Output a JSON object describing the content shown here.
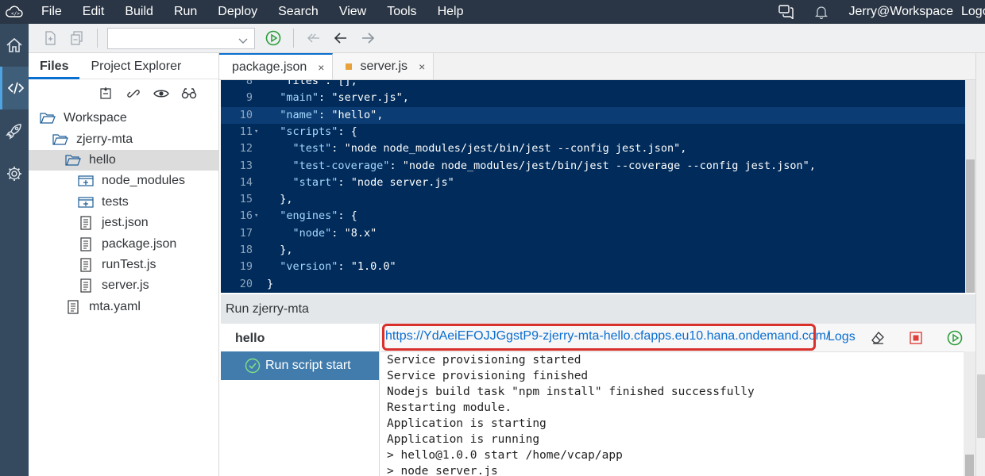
{
  "menubar": {
    "items": [
      "File",
      "Edit",
      "Build",
      "Run",
      "Deploy",
      "Search",
      "View",
      "Tools",
      "Help"
    ],
    "user": "Jerry@Workspace",
    "logout": "Logout"
  },
  "file_panel": {
    "tabs": [
      "Files",
      "Project Explorer"
    ],
    "tree": [
      {
        "label": "Workspace",
        "depth": 0,
        "icon": "folder-open-icon"
      },
      {
        "label": "zjerry-mta",
        "depth": 1,
        "icon": "folder-open-icon"
      },
      {
        "label": "hello",
        "depth": 2,
        "icon": "folder-open-icon",
        "selected": true
      },
      {
        "label": "node_modules",
        "depth": 3,
        "icon": "folder-closed-icon"
      },
      {
        "label": "tests",
        "depth": 3,
        "icon": "folder-closed-icon"
      },
      {
        "label": "jest.json",
        "depth": 3,
        "icon": "file-icon"
      },
      {
        "label": "package.json",
        "depth": 3,
        "icon": "file-icon"
      },
      {
        "label": "runTest.js",
        "depth": 3,
        "icon": "file-icon"
      },
      {
        "label": "server.js",
        "depth": 3,
        "icon": "file-icon"
      },
      {
        "label": "mta.yaml",
        "depth": 2,
        "icon": "file-icon"
      }
    ]
  },
  "editor_tabs": [
    {
      "label": "package.json",
      "active": true,
      "close": "×"
    },
    {
      "label": "server.js",
      "active": false,
      "modified": true,
      "close": "×"
    }
  ],
  "code_lines": [
    {
      "n": "8",
      "fold": false,
      "tokens": [
        [
          "s",
          "  \"files\": [],"
        ]
      ]
    },
    {
      "n": "9",
      "fold": false,
      "tokens": [
        [
          "s",
          "  "
        ],
        [
          "k",
          "\"main\""
        ],
        [
          "p",
          ": "
        ],
        [
          "s",
          "\"server.js\","
        ]
      ]
    },
    {
      "n": "10",
      "fold": false,
      "hl": true,
      "tokens": [
        [
          "s",
          "  "
        ],
        [
          "k",
          "\"name\""
        ],
        [
          "p",
          ": "
        ],
        [
          "s",
          "\"hello\","
        ]
      ]
    },
    {
      "n": "11",
      "fold": true,
      "tokens": [
        [
          "s",
          "  "
        ],
        [
          "k",
          "\"scripts\""
        ],
        [
          "p",
          ": {"
        ]
      ]
    },
    {
      "n": "12",
      "fold": false,
      "tokens": [
        [
          "s",
          "    "
        ],
        [
          "k",
          "\"test\""
        ],
        [
          "p",
          ": "
        ],
        [
          "s",
          "\"node node_modules/jest/bin/jest --config jest.json\","
        ]
      ]
    },
    {
      "n": "13",
      "fold": false,
      "tokens": [
        [
          "s",
          "    "
        ],
        [
          "k",
          "\"test-coverage\""
        ],
        [
          "p",
          ": "
        ],
        [
          "s",
          "\"node node_modules/jest/bin/jest --coverage --config jest.json\","
        ]
      ]
    },
    {
      "n": "14",
      "fold": false,
      "tokens": [
        [
          "s",
          "    "
        ],
        [
          "k",
          "\"start\""
        ],
        [
          "p",
          ": "
        ],
        [
          "s",
          "\"node server.js\""
        ]
      ]
    },
    {
      "n": "15",
      "fold": false,
      "tokens": [
        [
          "p",
          "  },"
        ]
      ]
    },
    {
      "n": "16",
      "fold": true,
      "tokens": [
        [
          "s",
          "  "
        ],
        [
          "k",
          "\"engines\""
        ],
        [
          "p",
          ": {"
        ]
      ]
    },
    {
      "n": "17",
      "fold": false,
      "tokens": [
        [
          "s",
          "    "
        ],
        [
          "k",
          "\"node\""
        ],
        [
          "p",
          ": "
        ],
        [
          "s",
          "\"8.x\""
        ]
      ]
    },
    {
      "n": "18",
      "fold": false,
      "tokens": [
        [
          "p",
          "  },"
        ]
      ]
    },
    {
      "n": "19",
      "fold": false,
      "tokens": [
        [
          "s",
          "  "
        ],
        [
          "k",
          "\"version\""
        ],
        [
          "p",
          ": "
        ],
        [
          "s",
          "\"1.0.0\""
        ]
      ]
    },
    {
      "n": "20",
      "fold": false,
      "tokens": [
        [
          "p",
          "}"
        ]
      ]
    }
  ],
  "fold_glyph": "▾",
  "run": {
    "header": "Run zjerry-mta",
    "app": "hello",
    "script": "Run script start",
    "url": "https://YdAeiEFOJJGgstP9-zjerry-mta-hello.cfapps.eu10.hana.ondemand.com/",
    "logs": "Logs",
    "console": [
      "Service provisioning started",
      "Service provisioning finished",
      "Nodejs build task \"npm install\" finished successfully",
      "Restarting module.",
      "Application is starting",
      "Application is running",
      "> hello@1.0.0 start /home/vcap/app",
      "> node server.js"
    ]
  },
  "colors": {
    "menubar": "#2a3645",
    "leftnav": "#354a5f",
    "editor_bg": "#002b5a",
    "run_script_bg": "#427cac",
    "highlight_box": "#d9302b",
    "link": "#0a6ed1"
  }
}
